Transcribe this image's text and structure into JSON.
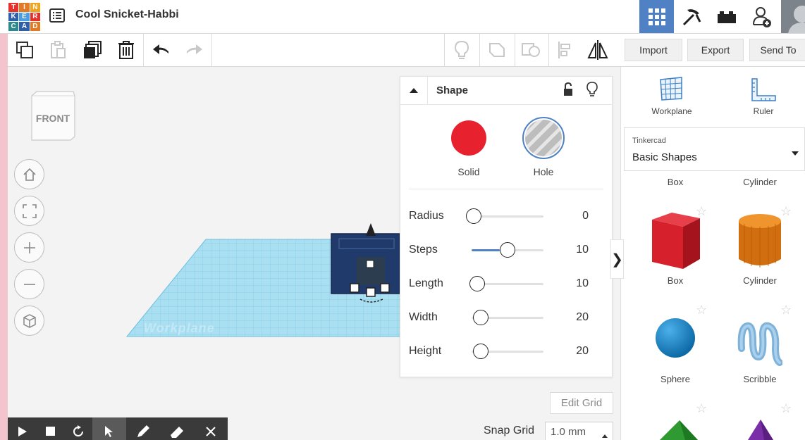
{
  "app": {
    "logo_letters": [
      "T",
      "I",
      "N",
      "K",
      "E",
      "R",
      "C",
      "A",
      "D"
    ],
    "logo_colors": [
      "#e5312c",
      "#e27a23",
      "#f2a31b",
      "#2f5fa8",
      "#4a9de0",
      "#e5312c",
      "#2d8a8c",
      "#2f5fa8",
      "#e27a23"
    ],
    "document_title": "Cool Snicket-Habbi",
    "accent_color": "#4f81c4"
  },
  "topbar": {
    "icons": [
      "grid-view-icon",
      "build-pickaxe-icon",
      "bricks-icon",
      "add-user-icon"
    ]
  },
  "toolbar": {
    "import_label": "Import",
    "export_label": "Export",
    "sendto_label": "Send To"
  },
  "viewcube": {
    "face_label": "FRONT"
  },
  "canvas": {
    "workplane_label": "Workplane"
  },
  "shape_panel": {
    "title": "Shape",
    "solid_label": "Solid",
    "hole_label": "Hole",
    "solid_color": "#e8212e",
    "params": [
      {
        "label": "Radius",
        "value": "0"
      },
      {
        "label": "Steps",
        "value": "10"
      },
      {
        "label": "Length",
        "value": "10"
      },
      {
        "label": "Width",
        "value": "20"
      },
      {
        "label": "Height",
        "value": "20"
      }
    ]
  },
  "library": {
    "workplane_label": "Workplane",
    "ruler_label": "Ruler",
    "category_small": "Tinkercad",
    "category": "Basic Shapes",
    "partial_labels": [
      "Box",
      "Cylinder"
    ],
    "shapes": [
      {
        "label": "Box",
        "color": "#d6202b"
      },
      {
        "label": "Cylinder",
        "color": "#e07a16"
      },
      {
        "label": "Sphere",
        "color": "#1a86c8"
      },
      {
        "label": "Scribble",
        "color": "#7fb2d8"
      }
    ]
  },
  "bottom": {
    "edit_grid_label": "Edit Grid",
    "snap_grid_label": "Snap Grid",
    "snap_value": "1.0 mm"
  }
}
